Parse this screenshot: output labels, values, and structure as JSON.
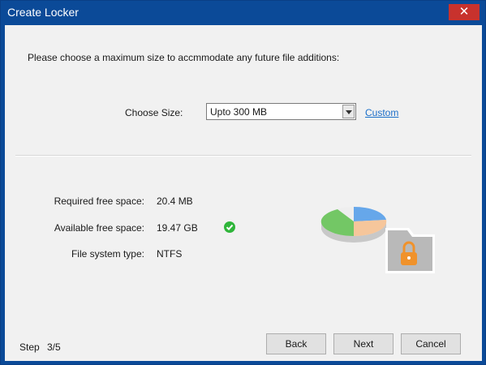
{
  "window": {
    "title": "Create Locker",
    "close_glyph": "✕"
  },
  "content": {
    "instruction": "Please choose a maximum size to accmmodate any future file additions:",
    "choose_size_label": "Choose Size:",
    "selected_size": "Upto 300 MB",
    "custom_link": "Custom"
  },
  "info": {
    "required_label": "Required free space:",
    "required_value": "20.4 MB",
    "available_label": "Available free space:",
    "available_value": "19.47 GB",
    "fs_label": "File system type:",
    "fs_value": "NTFS"
  },
  "footer": {
    "step_label": "Step",
    "step_value": "3/5",
    "back_label": "Back",
    "next_label": "Next",
    "cancel_label": "Cancel"
  },
  "icons": {
    "available_status": "check-circle-icon",
    "illustration": "locker-pie-folder-icon"
  },
  "colors": {
    "title_bar": "#0b4a98",
    "close": "#c8322d",
    "link": "#1a6fc9",
    "success": "#2fb53a",
    "lock": "#f0922b"
  }
}
